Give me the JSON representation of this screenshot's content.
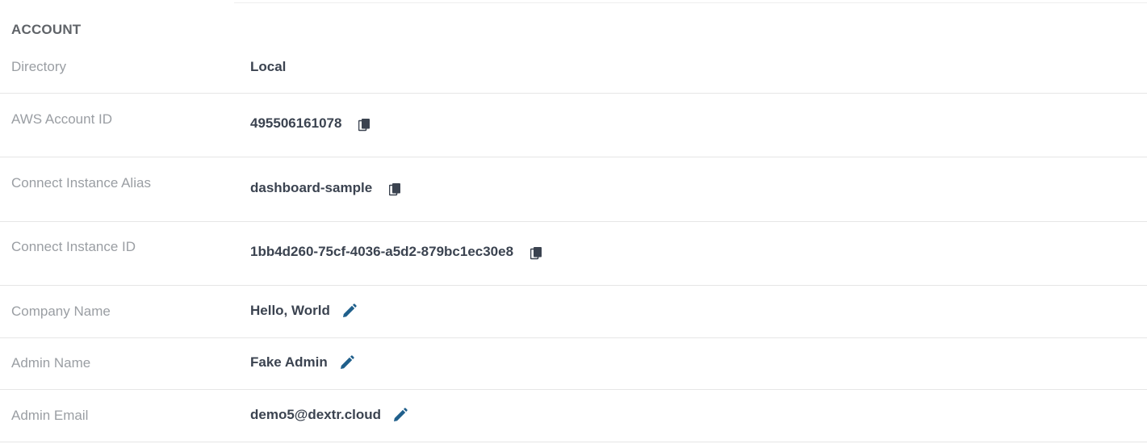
{
  "section": {
    "title": "ACCOUNT"
  },
  "rows": [
    {
      "label": "Directory",
      "value": "Local",
      "action": "none"
    },
    {
      "label": "AWS Account ID",
      "value": "495506161078",
      "action": "copy"
    },
    {
      "label": "Connect Instance Alias",
      "value": "dashboard-sample",
      "action": "copy"
    },
    {
      "label": "Connect Instance ID",
      "value": "1bb4d260-75cf-4036-a5d2-879bc1ec30e8",
      "action": "copy"
    },
    {
      "label": "Company Name",
      "value": "Hello, World",
      "action": "edit"
    },
    {
      "label": "Admin Name",
      "value": "Fake Admin",
      "action": "edit"
    },
    {
      "label": "Admin Email",
      "value": "demo5@dextr.cloud",
      "action": "edit"
    }
  ],
  "icons": {
    "copy": "copy-icon",
    "edit": "pencil-icon"
  },
  "colors": {
    "label": "#9a9ea3",
    "value": "#3b4350",
    "copy_icon": "#3b4350",
    "edit_icon": "#1f5f8b",
    "divider": "#e6e6e6"
  }
}
